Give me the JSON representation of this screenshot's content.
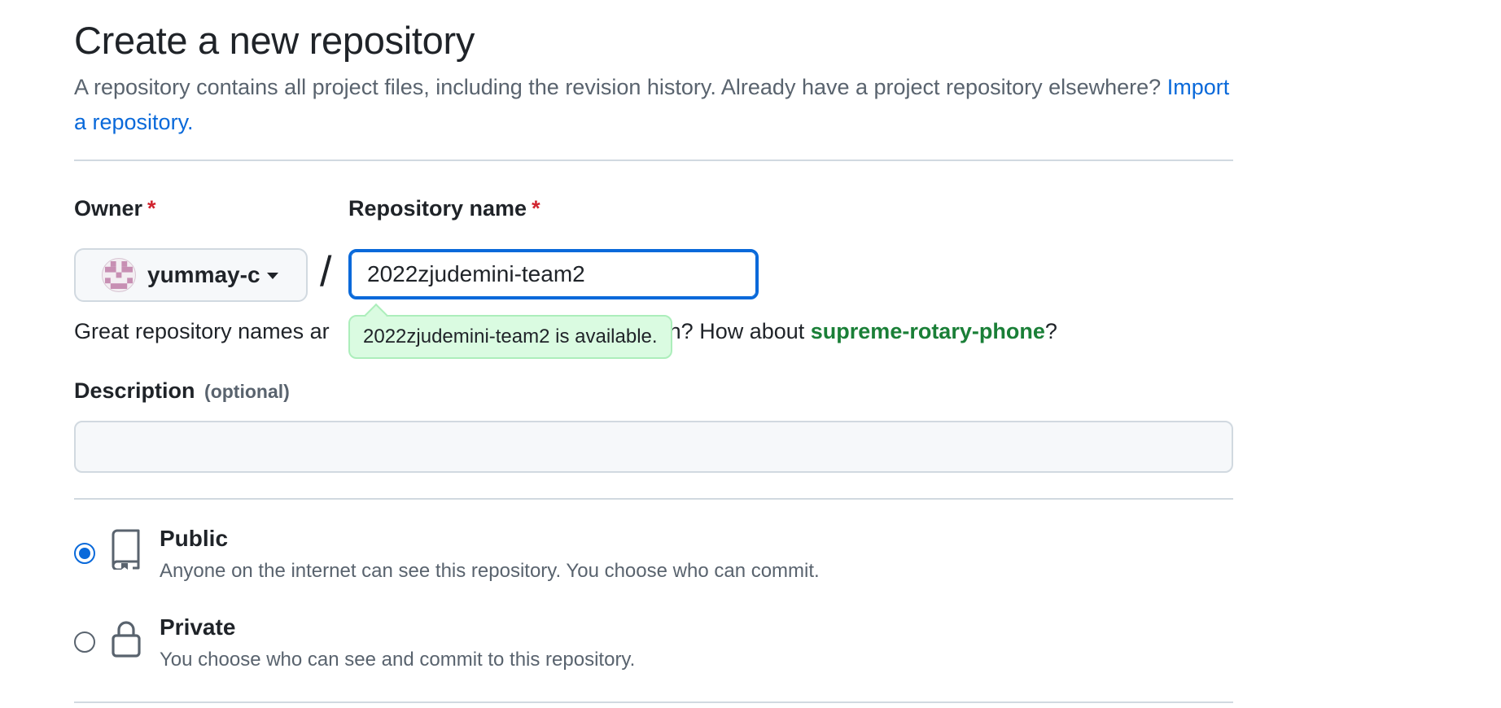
{
  "header": {
    "title": "Create a new repository",
    "subtitle": "A repository contains all project files, including the revision history. Already have a project repository elsewhere?",
    "import_link": "Import a repository."
  },
  "owner": {
    "label": "Owner",
    "required_mark": "*",
    "selected": "yummay-c",
    "avatar_icon": "identicon-avatar"
  },
  "separator": "/",
  "repo_name": {
    "label": "Repository name",
    "required_mark": "*",
    "value": "2022zjudemini-team2",
    "availability": "2022zjudemini-team2 is available."
  },
  "hint": {
    "prefix": "Great repository names ar",
    "middle": "spiration? How about ",
    "suggestion": "supreme-rotary-phone",
    "suffix": "?"
  },
  "description": {
    "label": "Description",
    "optional": "(optional)",
    "value": ""
  },
  "visibility": {
    "options": [
      {
        "title": "Public",
        "description": "Anyone on the internet can see this repository. You choose who can commit.",
        "icon": "repo-icon",
        "checked": true
      },
      {
        "title": "Private",
        "description": "You choose who can see and commit to this repository.",
        "icon": "lock-icon",
        "checked": false
      }
    ]
  },
  "colors": {
    "link": "#0969da",
    "success": "#1a7f37",
    "required": "#d1242f",
    "tooltip_bg": "#dafbe1"
  }
}
